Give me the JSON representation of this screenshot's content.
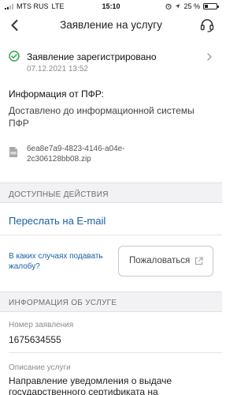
{
  "status_bar": {
    "carrier": "MTS RUS",
    "network": "LTE",
    "time": "15:10",
    "battery_text": "25 %",
    "battery_level": 0.25
  },
  "nav": {
    "title": "Заявление на услугу",
    "back_icon": "chevron-left-icon",
    "support_icon": "headset-icon"
  },
  "application_status": {
    "text": "Заявление зарегистрировано",
    "date": "07.12.2021 13:52",
    "icon": "check-circle-icon",
    "icon_color": "#2fa84f"
  },
  "info": {
    "title": "Информация от ПФР:",
    "body": "Доставлено до информационной системы ПФР"
  },
  "file": {
    "icon": "file-icon",
    "name": "6ea8e7a9-4823-4146-a04e-2c306128bb08.zip"
  },
  "actions_section": {
    "title": "ДОСТУПНЫЕ ДЕЙСТВИЯ",
    "email_link": "Переслать на E-mail",
    "complaint_question": "В каких случаях подавать жалобу?",
    "complaint_button": "Пожаловаться"
  },
  "service_section": {
    "title": "ИНФОРМАЦИЯ ОБ УСЛУГЕ",
    "number_label": "Номер заявления",
    "number_value": "1675634555",
    "description_label": "Описание услуги",
    "description_value": "Направление уведомления о выдаче государственного сертификата на"
  },
  "colors": {
    "accent_link": "#1a5fa8",
    "success": "#2fa84f",
    "section_bg": "#f2f2f4"
  }
}
